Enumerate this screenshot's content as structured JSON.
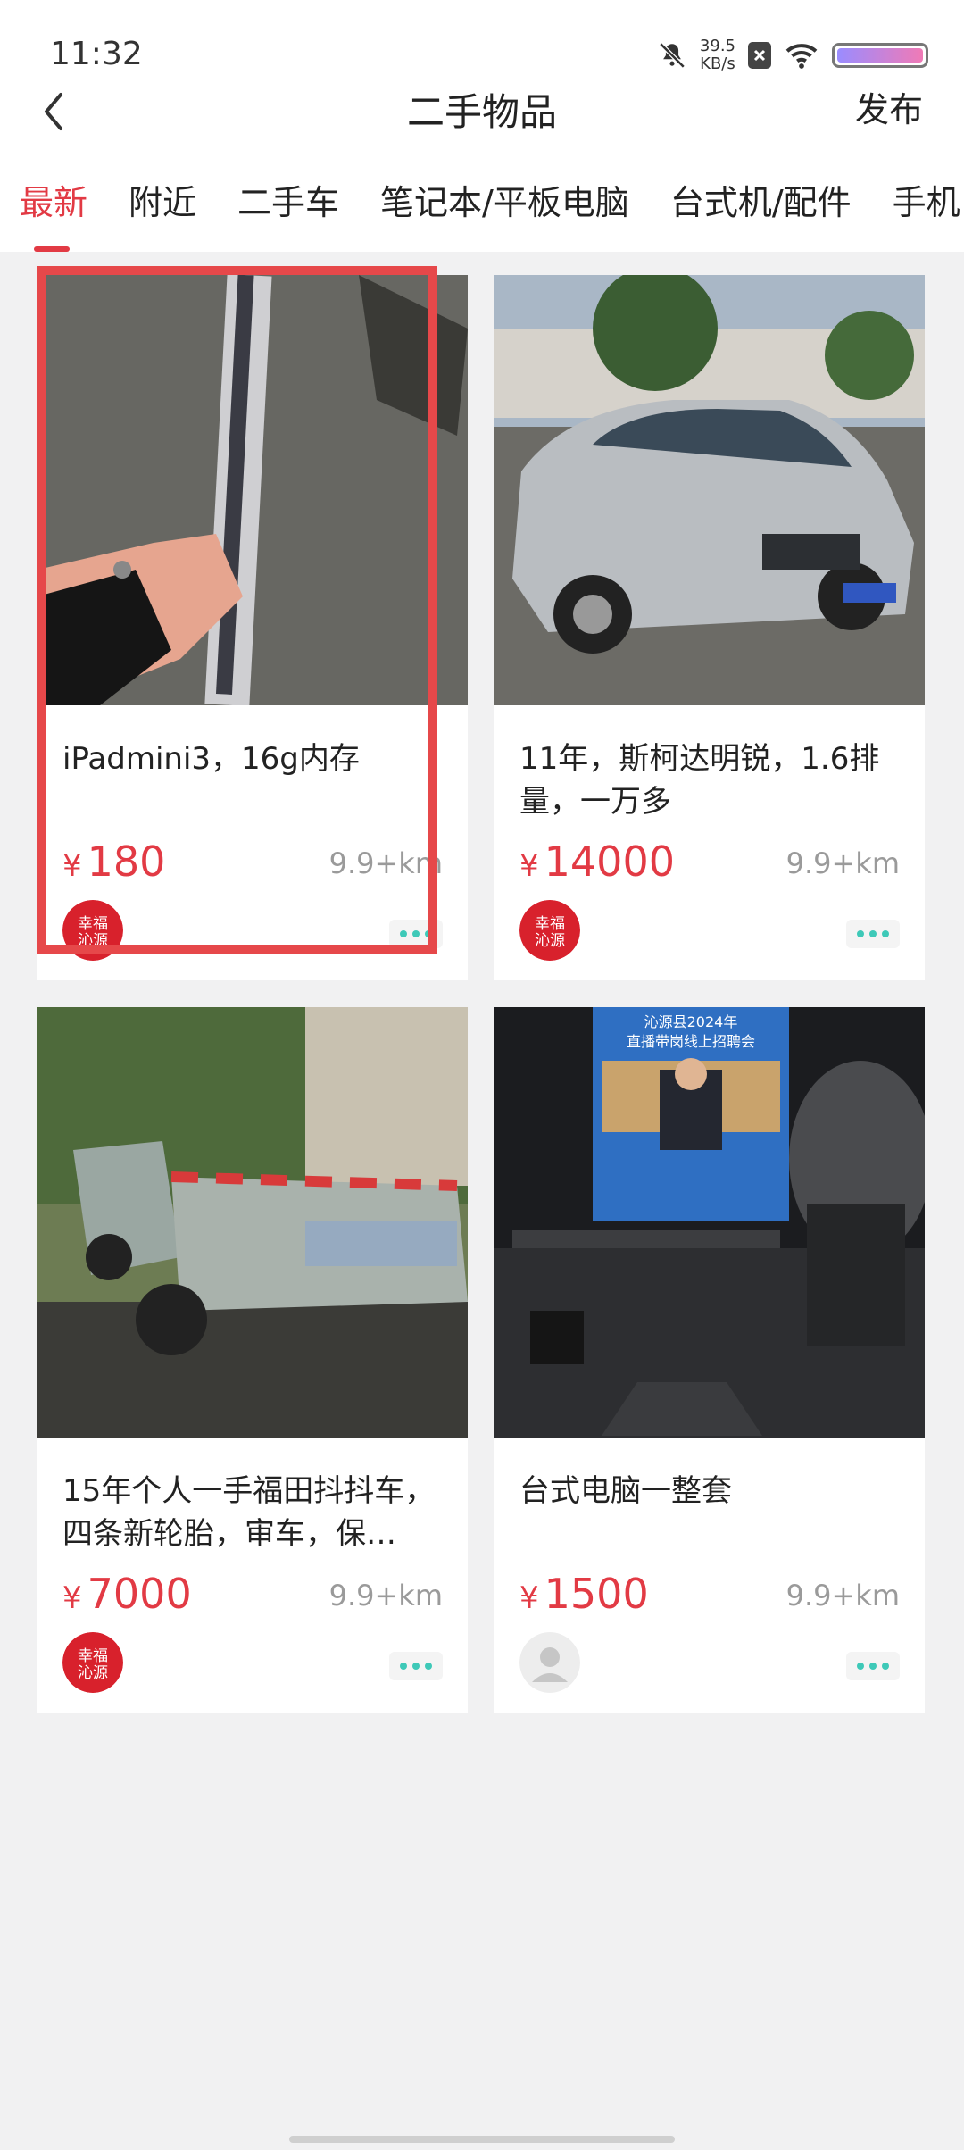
{
  "status": {
    "time": "11:32",
    "net_speed_value": "39.5",
    "net_speed_unit": "KB/s"
  },
  "header": {
    "title": "二手物品",
    "publish": "发布"
  },
  "tabs": [
    "最新",
    "附近",
    "二手车",
    "笔记本/平板电脑",
    "台式机/配件",
    "手机"
  ],
  "items": [
    {
      "title": "iPadmini3，16g内存",
      "currency": "¥",
      "price": "180",
      "distance": "9.9+km",
      "seller": "幸福沁源"
    },
    {
      "title": "11年，斯柯达明锐，1.6排量，一万多",
      "currency": "¥",
      "price": "14000",
      "distance": "9.9+km",
      "seller": "幸福沁源"
    },
    {
      "title": "15年个人一手福田抖抖车，四条新轮胎，审车，保…",
      "currency": "¥",
      "price": "7000",
      "distance": "9.9+km",
      "seller": "幸福沁源"
    },
    {
      "title": "台式电脑一整套",
      "currency": "¥",
      "price": "1500",
      "distance": "9.9+km",
      "seller": ""
    }
  ],
  "images": {
    "item0": {
      "hint": "hand-holding-ipad"
    },
    "item1": {
      "hint": "silver-car"
    },
    "item2": {
      "hint": "truck"
    },
    "item3": {
      "hint": "monitor-and-mic",
      "screen_text_1": "沁源县2024年",
      "screen_text_2": "直播带岗线上招聘会"
    }
  },
  "colors": {
    "accent": "#e23a44",
    "highlight": "#e6484a",
    "dots": "#3ec9b8"
  }
}
